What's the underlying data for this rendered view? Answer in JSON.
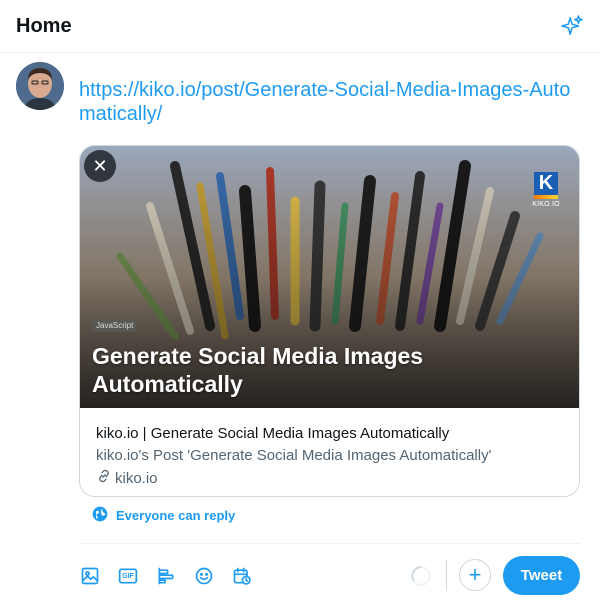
{
  "header": {
    "title": "Home",
    "sparkle_icon": "sparkle-icon"
  },
  "composer": {
    "text": "https://kiko.io/post/Generate-Social-Media-Images-Automatically/"
  },
  "card": {
    "brand": {
      "letter": "K",
      "text": "KIKO.IO"
    },
    "tag": "JavaScript",
    "overlay_title": "Generate Social Media Images Automatically",
    "title": "kiko.io | Generate Social Media Images Automatically",
    "description": "kiko.io's Post 'Generate Social Media Images Automatically'",
    "domain": "kiko.io",
    "close_symbol": "✕"
  },
  "reply_setting": "Everyone can reply",
  "toolbar": {
    "icons": [
      "image-icon",
      "gif-icon",
      "poll-icon",
      "emoji-icon",
      "schedule-icon"
    ],
    "gif_label": "GIF",
    "add_symbol": "+",
    "tweet_label": "Tweet"
  },
  "colors": {
    "accent": "#1d9bf0",
    "text": "#0f1419",
    "secondary": "#536471",
    "border": "#cfd9de"
  }
}
